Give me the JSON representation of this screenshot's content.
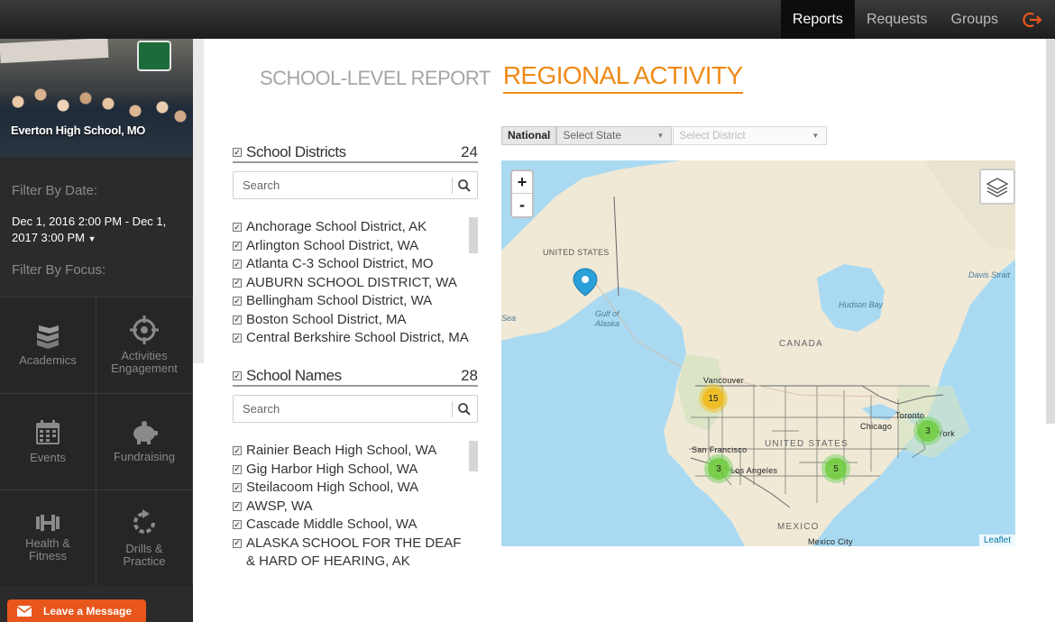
{
  "nav": {
    "items": [
      "Reports",
      "Requests",
      "Groups"
    ],
    "active": "Reports"
  },
  "sidebar": {
    "school_name": "Everton High School, MO",
    "filter_date_label": "Filter By Date:",
    "date_range": "Dec 1, 2016 2:00 PM - Dec 1, 2017 3:00 PM",
    "filter_focus_label": "Filter By Focus:",
    "focus_tiles": [
      {
        "label": "Academics",
        "icon": "books-icon"
      },
      {
        "label": "Activities Engagement",
        "icon": "target-icon"
      },
      {
        "label": "Events",
        "icon": "calendar-icon"
      },
      {
        "label": "Fundraising",
        "icon": "piggy-bank-icon"
      },
      {
        "label": "Health & Fitness",
        "icon": "dumbbell-icon"
      },
      {
        "label": "Drills & Practice",
        "icon": "refresh-icon"
      }
    ]
  },
  "leave_message": "Leave a Message",
  "tabs": {
    "inactive": "SCHOOL-LEVEL REPORT",
    "active": "REGIONAL ACTIVITY"
  },
  "districts": {
    "title": "School Districts",
    "count": "24",
    "search_placeholder": "Search",
    "items": [
      "Anchorage School District, AK",
      "Arlington School District, WA",
      "Atlanta C-3 School District, MO",
      "AUBURN SCHOOL DISTRICT, WA",
      "Bellingham School District, WA",
      "Boston School District, MA",
      "Central Berkshire School District, MA"
    ]
  },
  "schools": {
    "title": "School Names",
    "count": "28",
    "search_placeholder": "Search",
    "items": [
      "Rainier Beach High School, WA",
      "Gig Harbor High School, WA",
      "Steilacoom High School, WA",
      "AWSP, WA",
      "Cascade Middle School, WA",
      "ALASKA SCHOOL FOR THE DEAF & HARD OF HEARING, AK"
    ]
  },
  "map_controls": {
    "national": "National",
    "state_placeholder": "Select State",
    "district_placeholder": "Select District",
    "zoom_in": "+",
    "zoom_out": "-",
    "attribution": "Leaflet"
  },
  "map_labels": {
    "united_states_ak": "UNITED STATES",
    "gulf_of_alaska": "Gulf of Alaska",
    "sea": "Sea",
    "canada": "CANADA",
    "hudson_bay": "Hudson Bay",
    "davis_strait": "Davis Strait",
    "vancouver": "Vancouver",
    "san_francisco": "San Francisco",
    "los_angeles": "Los Angeles",
    "united_states": "UNITED STATES",
    "chicago": "Chicago",
    "toronto": "Toronto",
    "york": "York",
    "mexico": "MEXICO",
    "mexico_city": "Mexico City"
  },
  "clusters": [
    {
      "count": "15",
      "color": "#f1c232"
    },
    {
      "count": "3",
      "color": "#7ed36a"
    },
    {
      "count": "5",
      "color": "#7ed36a"
    },
    {
      "count": "3",
      "color": "#7ed36a"
    }
  ],
  "colors": {
    "accent": "#f08a16",
    "leave_message_bg": "#e8561c",
    "marker": "#2a9fd8"
  }
}
